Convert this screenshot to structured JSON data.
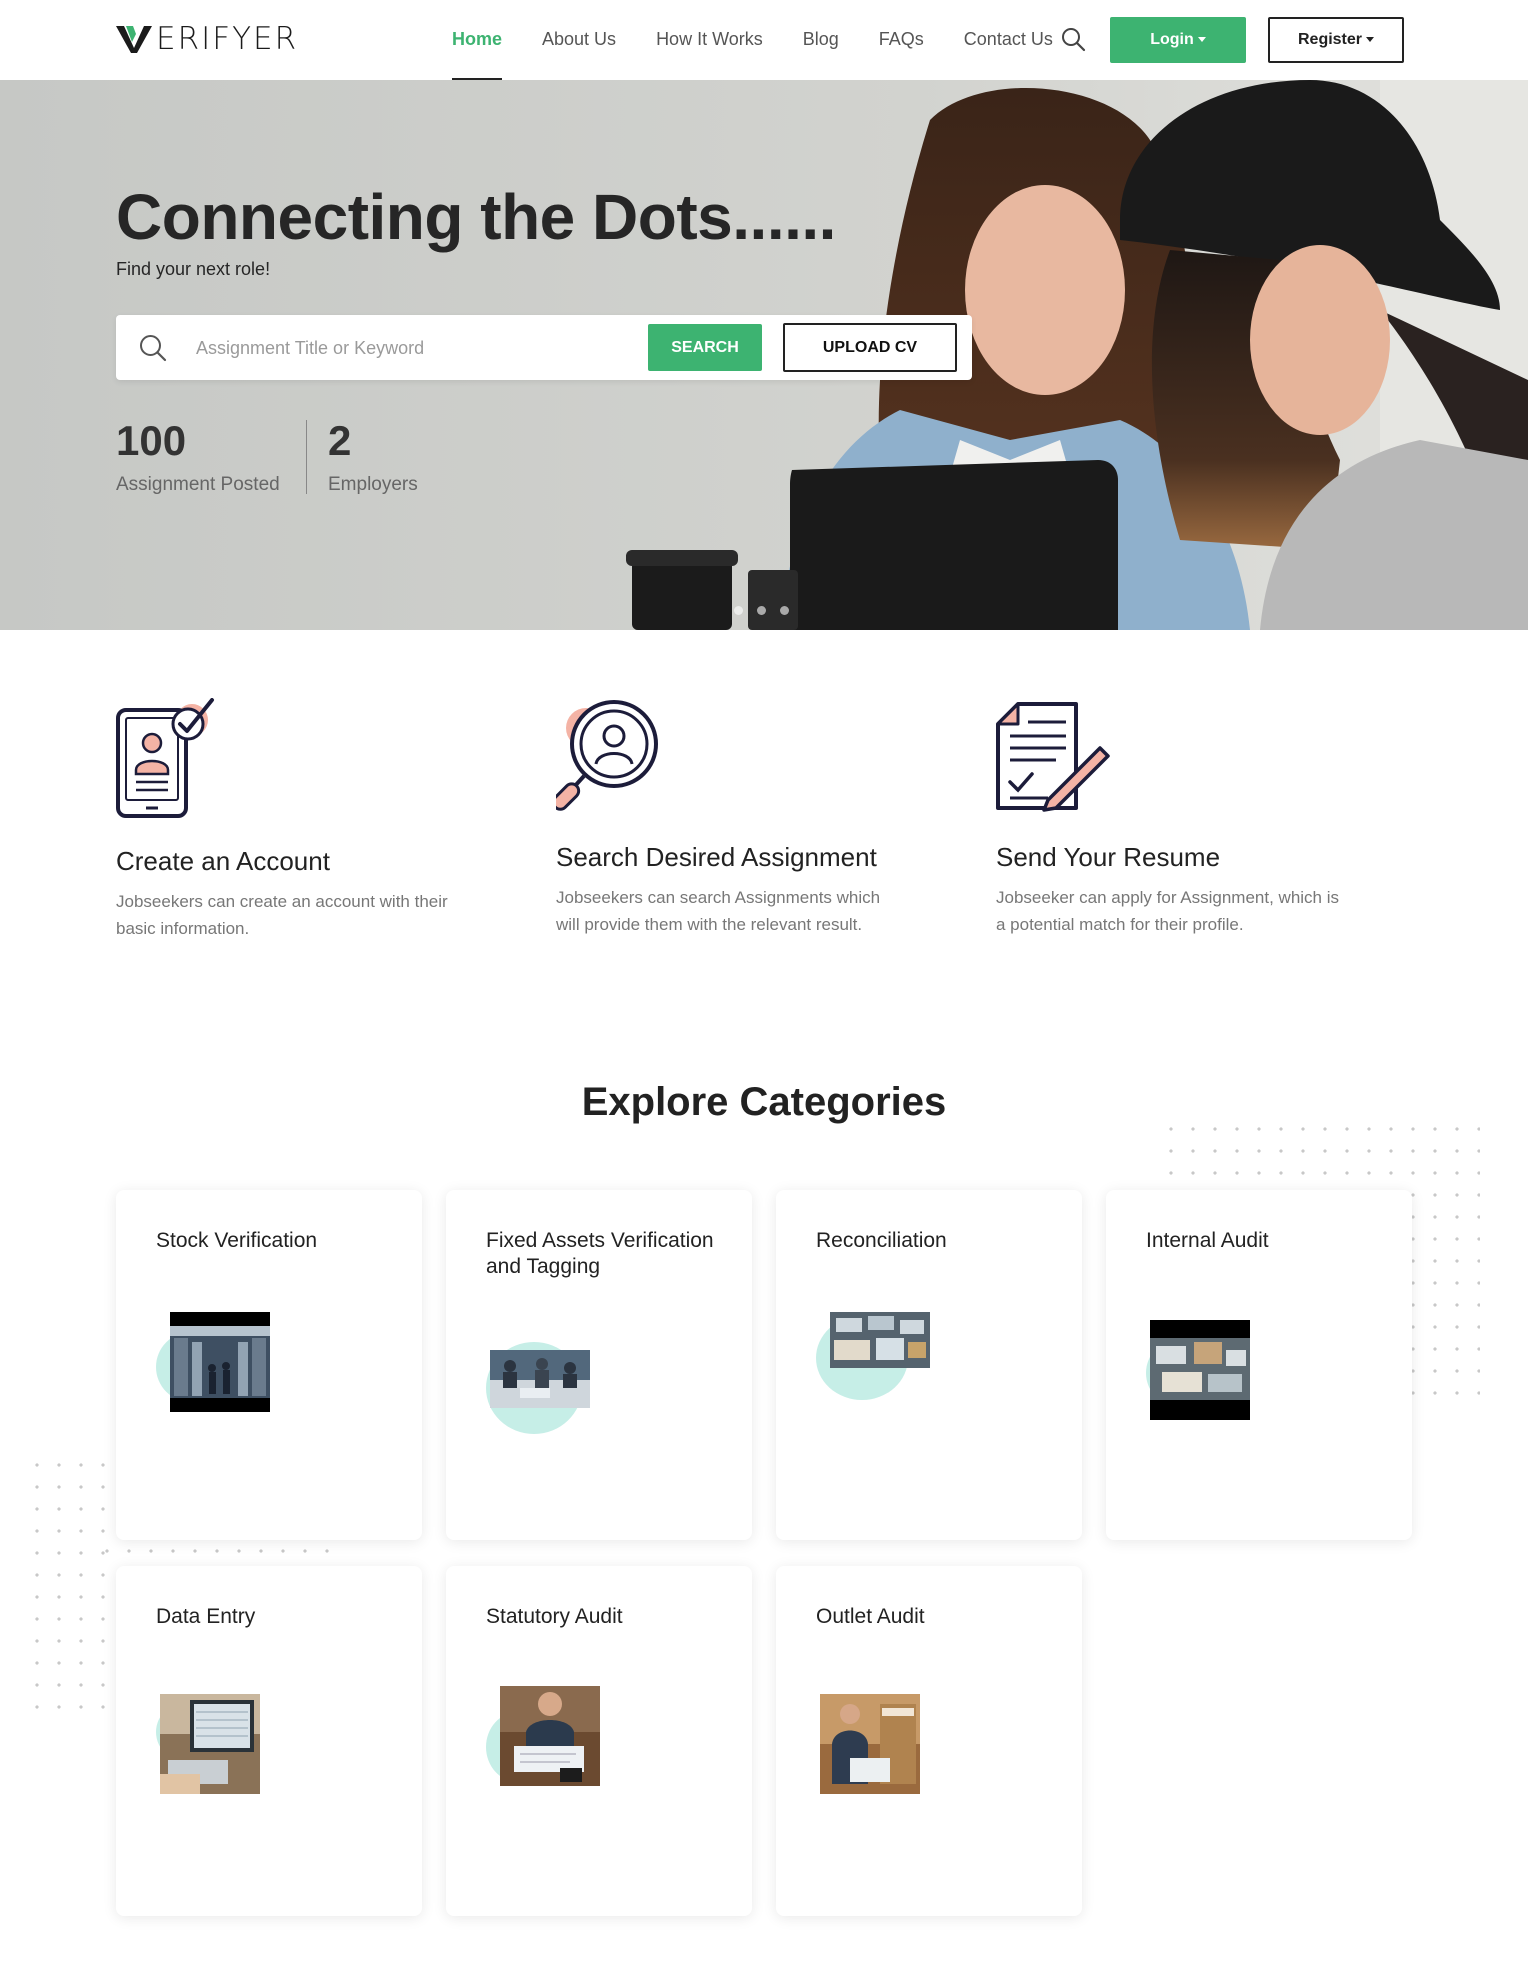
{
  "header": {
    "logo_text": "ERIFYER",
    "nav": [
      "Home",
      "About Us",
      "How It Works",
      "Blog",
      "FAQs",
      "Contact Us"
    ],
    "login_label": "Login",
    "register_label": "Register"
  },
  "hero": {
    "title": "Connecting the Dots......",
    "subtitle": "Find your next role!",
    "search_placeholder": "Assignment Title or Keyword",
    "search_button": "SEARCH",
    "upload_button": "UPLOAD CV",
    "stats": [
      {
        "number": "100",
        "label": "Assignment Posted"
      },
      {
        "number": "2",
        "label": "Employers"
      }
    ],
    "slides": 3
  },
  "steps": [
    {
      "title": "Create an Account",
      "desc": "Jobseekers can create an account with their basic information."
    },
    {
      "title": "Search Desired Assignment",
      "desc": "Jobseekers can search Assignments which will provide them with the relevant result."
    },
    {
      "title": "Send Your Resume",
      "desc": "Jobseeker can apply for Assignment, which is a potential match for their profile."
    }
  ],
  "categories": {
    "title_word1": "Explore",
    "title_word2": "Categories",
    "items": [
      {
        "name": "Stock Verification"
      },
      {
        "name": "Fixed Assets Verification and Tagging"
      },
      {
        "name": "Reconciliation"
      },
      {
        "name": "Internal Audit"
      },
      {
        "name": "Data Entry"
      },
      {
        "name": "Statutory Audit"
      },
      {
        "name": "Outlet Audit"
      }
    ]
  },
  "colors": {
    "accent": "#3db371",
    "blob": "#c6eee7",
    "icon_stroke": "#1c1c3a",
    "icon_fill": "#f4b3a5"
  }
}
